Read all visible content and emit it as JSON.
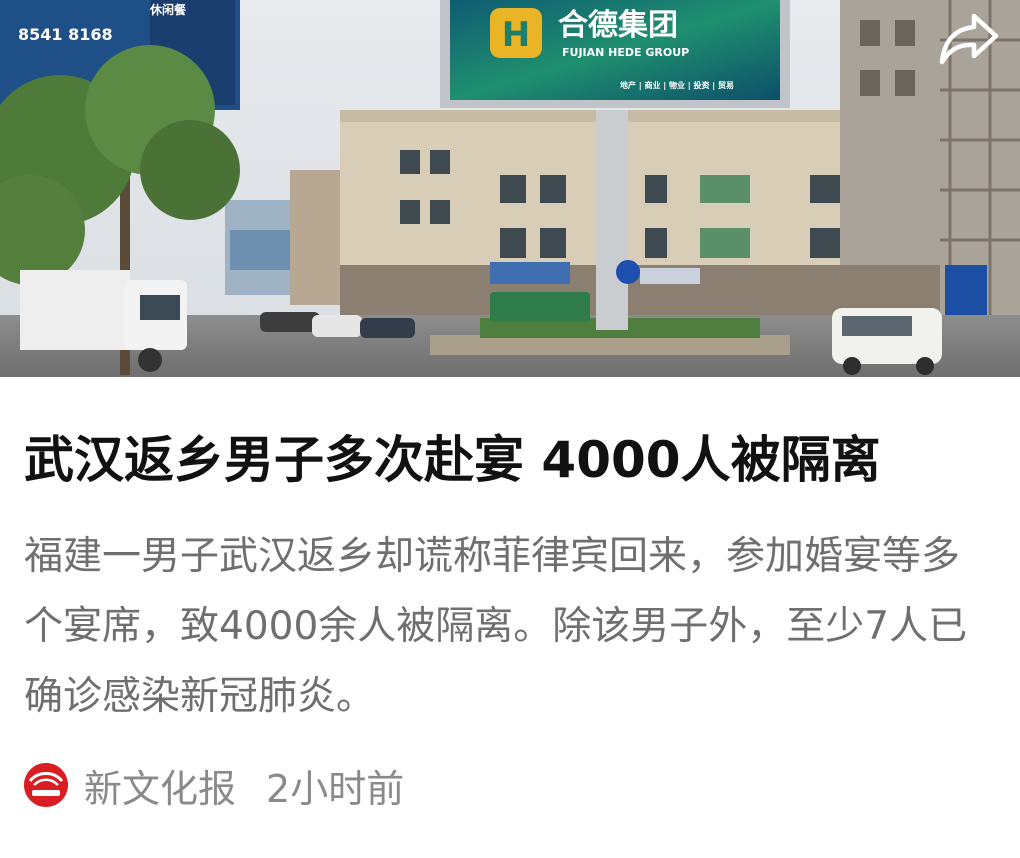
{
  "hero_image": {
    "alt": "Street scene with buildings and billboard",
    "billboard": {
      "title": "合德集团",
      "subtitle": "FUJIAN HEDE GROUP",
      "logo_letter": "H",
      "fine_print": "地产 | 商业 | 物业 | 投资 | 贸易"
    },
    "left_sign": {
      "phone": "8541 8168",
      "tag": "休闲餐"
    }
  },
  "share_icon": "share-arrow-icon",
  "article": {
    "headline": "武汉返乡男子多次赴宴 4000人被隔离",
    "summary": "福建一男子武汉返乡却谎称菲律宾回来，参加婚宴等多个宴席，致4000余人被隔离。除该男子外，至少7人已确诊感染新冠肺炎。",
    "source_name": "新文化报",
    "time_ago": "2小时前",
    "source_logo_icon": "newspaper-logo-icon"
  },
  "colors": {
    "headline": "#111111",
    "summary": "#6f6f6f",
    "meta": "#8a8a8a",
    "source_logo": "#d81e22",
    "billboard_bg": "#1d7f6a",
    "billboard_gold": "#e9b526"
  }
}
